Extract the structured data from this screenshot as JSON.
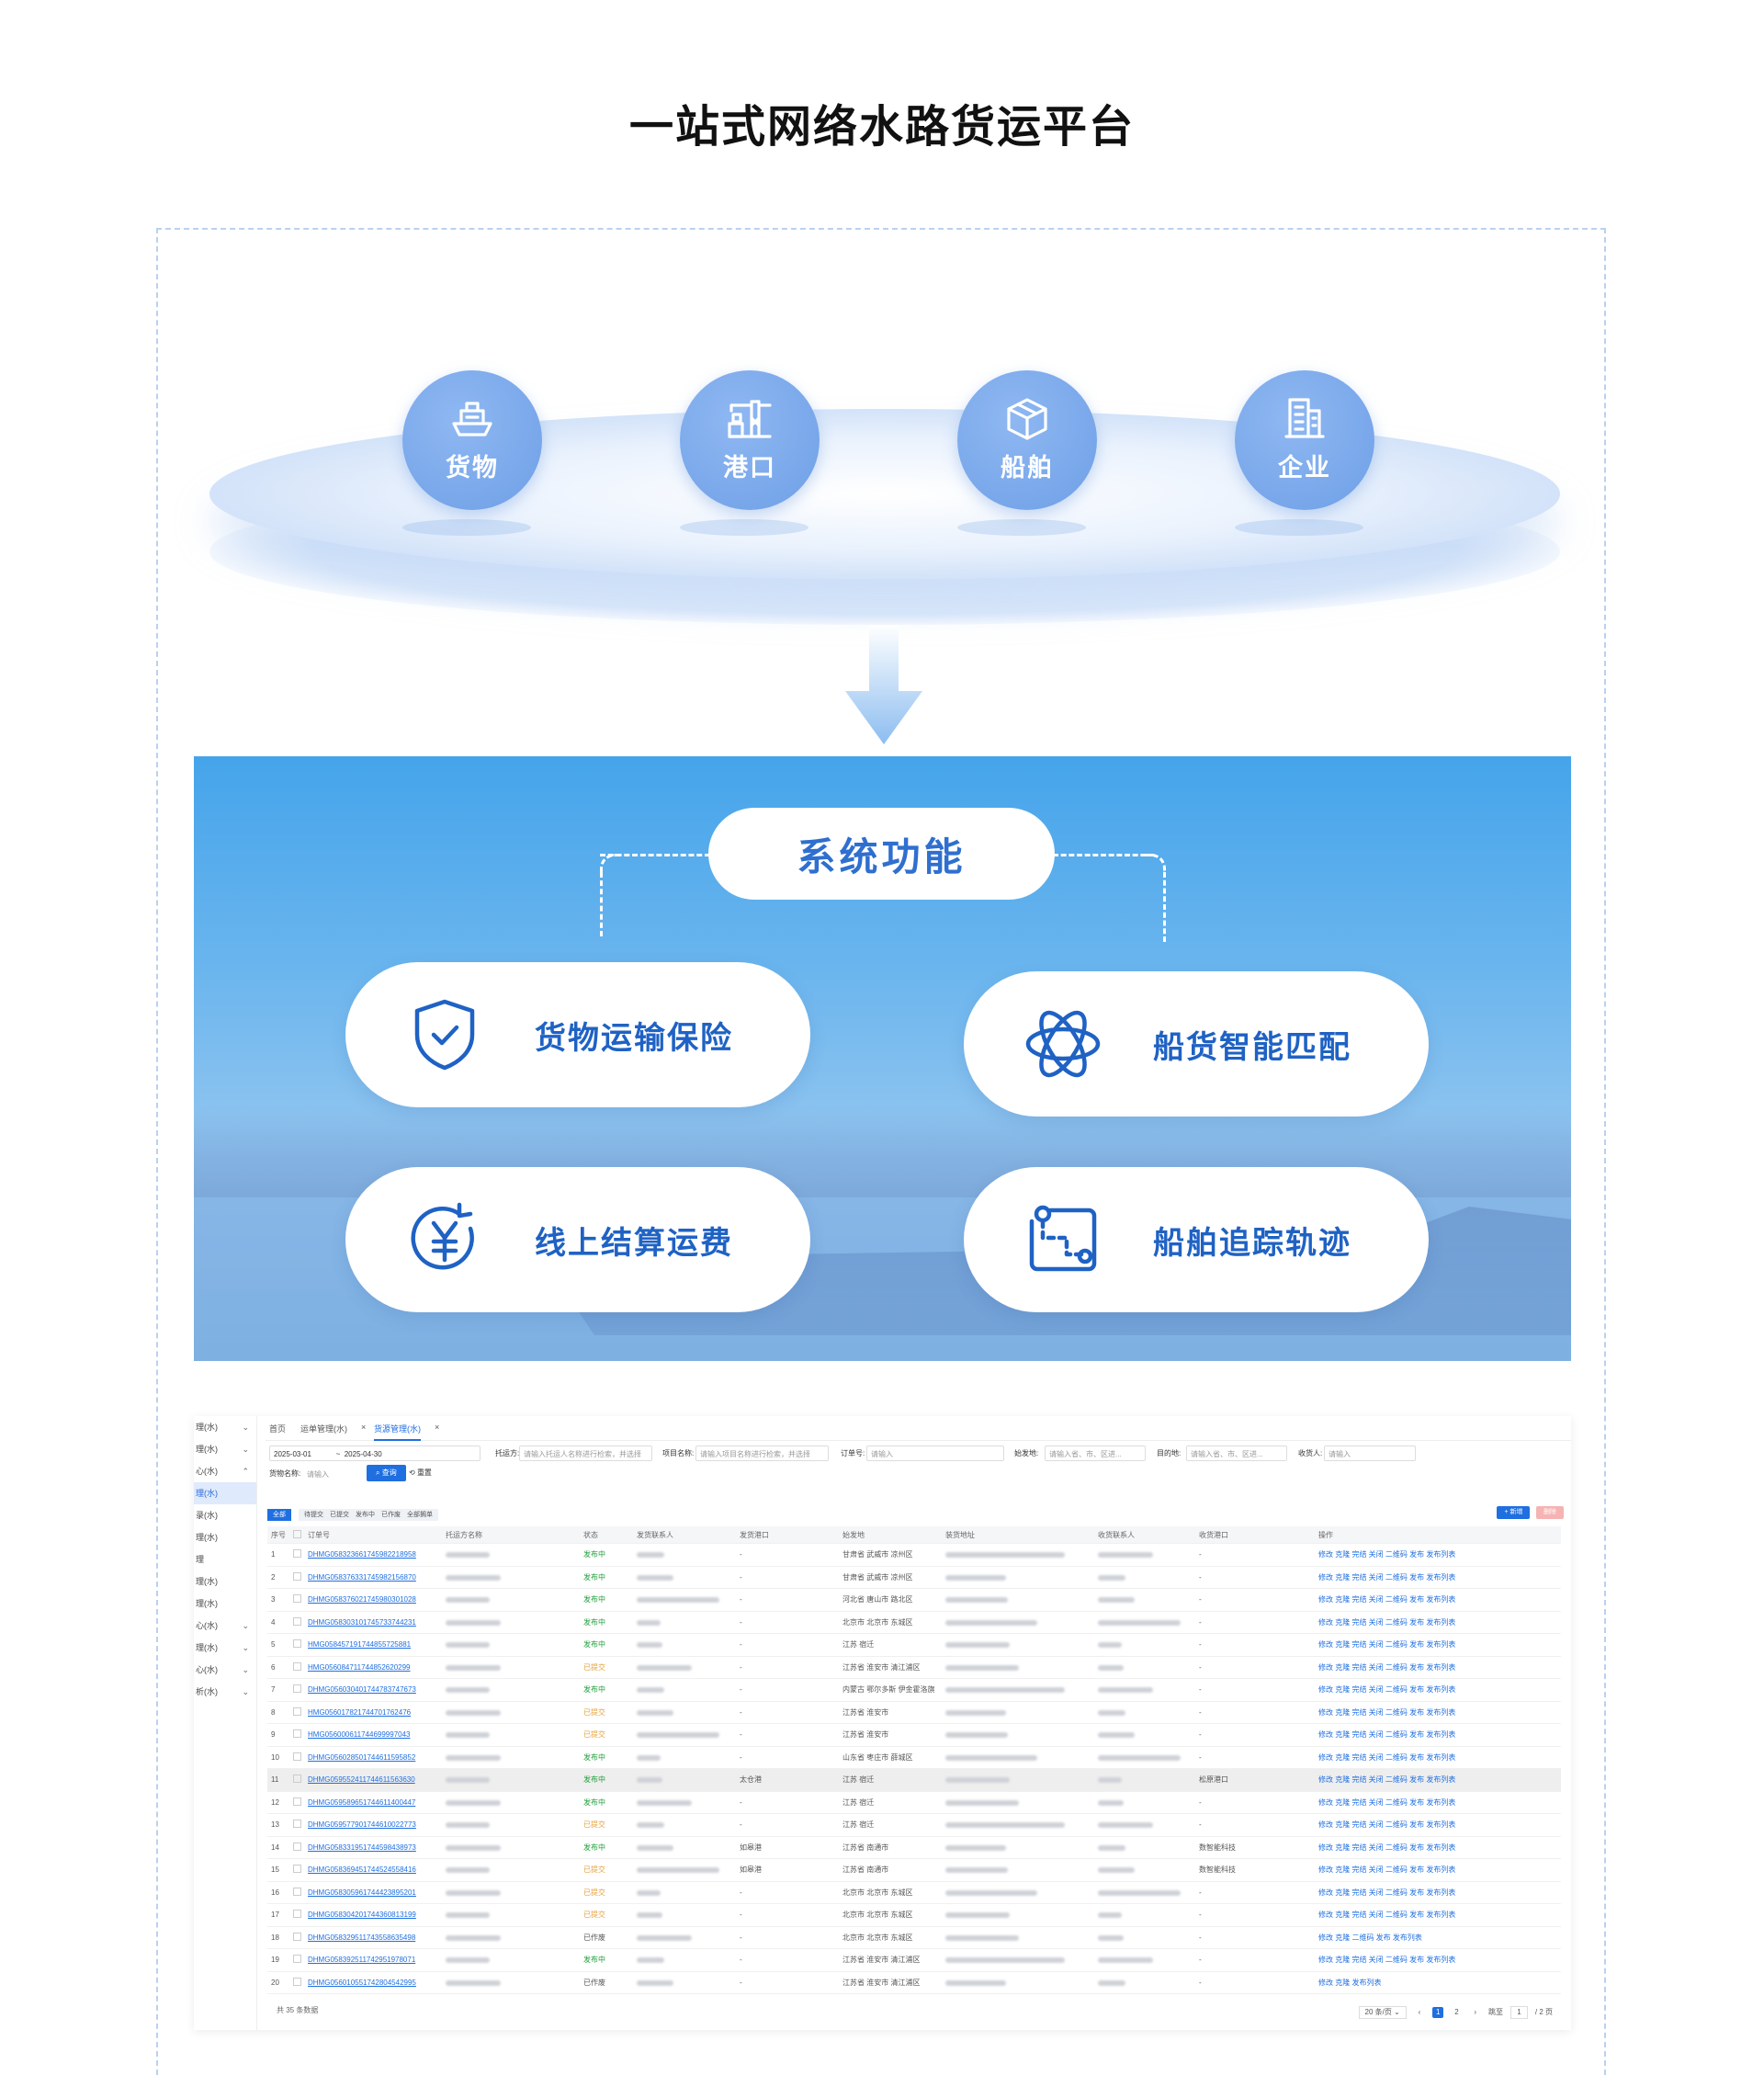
{
  "page_title": "一站式网络水路货运平台",
  "nodes": [
    {
      "label": "货物",
      "icon": "ship-icon"
    },
    {
      "label": "港口",
      "icon": "port-crane-icon"
    },
    {
      "label": "船舶",
      "icon": "cube-box-icon"
    },
    {
      "label": "企业",
      "icon": "building-icon"
    }
  ],
  "panel": {
    "title": "系统功能",
    "cards": [
      {
        "label": "货物运输保险",
        "icon": "shield-check-icon"
      },
      {
        "label": "船货智能匹配",
        "icon": "atom-icon"
      },
      {
        "label": "线上结算运费",
        "icon": "yuan-cycle-icon"
      },
      {
        "label": "船舶追踪轨迹",
        "icon": "route-track-icon"
      }
    ]
  },
  "colors": {
    "accent": "#1f6fe0",
    "node": "#7aa6ea",
    "panel_top": "#45a4ea",
    "card_text": "#1f62c4"
  },
  "app": {
    "sidebar": [
      {
        "label": "理(水)",
        "chevron": "⌄"
      },
      {
        "label": "理(水)",
        "chevron": "⌄"
      },
      {
        "label": "心(水)",
        "chevron": "⌃"
      },
      {
        "label": "理(水)",
        "chevron": "",
        "active": true
      },
      {
        "label": "录(水)",
        "chevron": ""
      },
      {
        "label": "理(水)",
        "chevron": ""
      },
      {
        "label": "理",
        "chevron": ""
      },
      {
        "label": "理(水)",
        "chevron": ""
      },
      {
        "label": "理(水)",
        "chevron": ""
      },
      {
        "label": "心(水)",
        "chevron": "⌄"
      },
      {
        "label": "理(水)",
        "chevron": "⌄"
      },
      {
        "label": "心(水)",
        "chevron": "⌄"
      },
      {
        "label": "析(水)",
        "chevron": "⌄"
      }
    ],
    "tabs": [
      "首页",
      "运单管理(水)",
      "货源管理(水)"
    ],
    "tab_close": "×",
    "filters": {
      "date_start": "2025-03-01",
      "date_sep": "~",
      "date_end": "2025-04-30",
      "shipper_label": "托运方:",
      "shipper_ph": "请输入托运人名称进行检索，并选择",
      "project_label": "项目名称:",
      "project_ph": "请输入项目名称进行检索，并选择",
      "order_label": "订单号:",
      "order_ph": "请输入",
      "origin_label": "始发地:",
      "origin_ph": "请输入省、市、区进...",
      "dest_label": "目的地:",
      "dest_ph": "请输入省、市、区进...",
      "receiver_label": "收货人:",
      "receiver_ph": "请输入",
      "cargo_label": "货物名称:",
      "cargo_ph": "请输入",
      "query": "查询",
      "reset": "重置"
    },
    "status_tabs": [
      "全部",
      "待提交",
      "已提交",
      "发布中",
      "已作废",
      "全部搁单"
    ],
    "add_label": "+ 新增",
    "del_label": "删除",
    "columns": [
      "序号",
      "",
      "订单号",
      "托运方名称",
      "状态",
      "发货联系人",
      "发货港口",
      "始发地",
      "装货地址",
      "收货联系人",
      "收货港口",
      "操作"
    ],
    "rows": [
      {
        "n": "1",
        "order": "DHMG0583236617459822​18958",
        "status": "发布中",
        "port": "-",
        "origin": "甘肃省 武威市 凉州区",
        "rport": "-",
        "ops": "修改 克隆 完结 关闭 二维码 发布 发布列表"
      },
      {
        "n": "2",
        "order": "DHMG058376331745982156870",
        "status": "发布中",
        "port": "-",
        "origin": "甘肃省 武威市 凉州区",
        "rport": "-",
        "ops": "修改 克隆 完结 关闭 二维码 发布 发布列表"
      },
      {
        "n": "3",
        "order": "DHMG058376021745980301028",
        "status": "发布中",
        "port": "-",
        "origin": "河北省 唐山市 路北区",
        "rport": "-",
        "ops": "修改 克隆 完结 关闭 二维码 发布 发布列表"
      },
      {
        "n": "4",
        "order": "DHMG058303101745733744231",
        "status": "发布中",
        "port": "-",
        "origin": "北京市 北京市 东城区",
        "rport": "-",
        "ops": "修改 克隆 完结 关闭 二维码 发布 发布列表"
      },
      {
        "n": "5",
        "order": "HMG0584571917448557​25881",
        "status": "发布中",
        "port": "-",
        "origin": "江苏 宿迁",
        "rport": "-",
        "ops": "修改 克隆 完结 关闭 二维码 发布 发布列表"
      },
      {
        "n": "6",
        "order": "HMG056084711744852620299",
        "status": "已提交",
        "port": "-",
        "origin": "江苏省 淮安市 清江浦区",
        "rport": "-",
        "ops": "修改 克隆 完结 关闭 二维码 发布 发布列表"
      },
      {
        "n": "7",
        "order": "DHMG056030401744783747673",
        "status": "发布中",
        "port": "-",
        "origin": "内蒙古 鄂尔多斯 伊金霍洛旗",
        "rport": "-",
        "ops": "修改 克隆 完结 关闭 二维码 发布 发布列表"
      },
      {
        "n": "8",
        "order": "HMG056017821744701762476",
        "status": "已提交",
        "port": "-",
        "origin": "江苏省 淮安市",
        "rport": "-",
        "ops": "修改 克隆 完结 关闭 二维码 发布 发布列表"
      },
      {
        "n": "9",
        "order": "HMG056000611744699997043",
        "status": "已提交",
        "port": "-",
        "origin": "江苏省 淮安市",
        "rport": "-",
        "ops": "修改 克隆 完结 关闭 二维码 发布 发布列表"
      },
      {
        "n": "10",
        "order": "DHMG056028501744611595852",
        "status": "发布中",
        "port": "-",
        "origin": "山东省 枣庄市 薛城区",
        "rport": "-",
        "ops": "修改 克隆 完结 关闭 二维码 发布 发布列表"
      },
      {
        "n": "11",
        "order": "DHMG059552411744611563630",
        "status": "发布中",
        "port": "太仓港",
        "origin": "江苏 宿迁",
        "rport": "松原港口",
        "ops": "修改 克隆 完结 关闭 二维码 发布 发布列表",
        "hl": true
      },
      {
        "n": "12",
        "order": "DHMG059589651744611400447",
        "status": "发布中",
        "port": "-",
        "origin": "江苏 宿迁",
        "rport": "-",
        "ops": "修改 克隆 完结 关闭 二维码 发布 发布列表"
      },
      {
        "n": "13",
        "order": "DHMG059577901744610022773",
        "status": "已提交",
        "port": "-",
        "origin": "江苏 宿迁",
        "rport": "-",
        "ops": "修改 克隆 完结 关闭 二维码 发布 发布列表"
      },
      {
        "n": "14",
        "order": "DHMG058331951744598438973",
        "status": "发布中",
        "port": "如皋港",
        "origin": "江苏省 南通市",
        "rport": "数智能科技",
        "ops": "修改 克隆 完结 关闭 二维码 发布 发布列表"
      },
      {
        "n": "15",
        "order": "DHMG058369451744524558416",
        "status": "已提交",
        "port": "如皋港",
        "origin": "江苏省 南通市",
        "rport": "数智能科技",
        "ops": "修改 克隆 完结 关闭 二维码 发布 发布列表"
      },
      {
        "n": "16",
        "order": "DHMG058305961744423895201",
        "status": "已提交",
        "port": "-",
        "origin": "北京市 北京市 东城区",
        "rport": "-",
        "ops": "修改 克隆 完结 关闭 二维码 发布 发布列表"
      },
      {
        "n": "17",
        "order": "DHMG058304201744360813199",
        "status": "已提交",
        "port": "-",
        "origin": "北京市 北京市 东城区",
        "rport": "-",
        "ops": "修改 克隆 完结 关闭 二维码 发布 发布列表"
      },
      {
        "n": "18",
        "order": "DHMG058329511743558635498",
        "status": "已作废",
        "port": "-",
        "origin": "北京市 北京市 东城区",
        "rport": "-",
        "ops": "修改 克隆 二维码 发布 发布列表"
      },
      {
        "n": "19",
        "order": "DHMG058392511742951978071",
        "status": "发布中",
        "port": "-",
        "origin": "江苏省 淮安市 清江浦区",
        "rport": "-",
        "ops": "修改 克隆 完结 关闭 二维码 发布 发布列表"
      },
      {
        "n": "20",
        "order": "DHMG056010551742804542995",
        "status": "已作废",
        "port": "-",
        "origin": "江苏省 淮安市 清江浦区",
        "rport": "-",
        "ops": "修改 克隆 发布列表"
      }
    ],
    "total": "共 35 条数据",
    "pager": {
      "size": "20 条/页 ⌄",
      "prev": "‹",
      "pages": [
        "1",
        "2"
      ],
      "next": "›",
      "jump": "跳至",
      "jump_val": "1",
      "of": "/ 2 页"
    }
  }
}
